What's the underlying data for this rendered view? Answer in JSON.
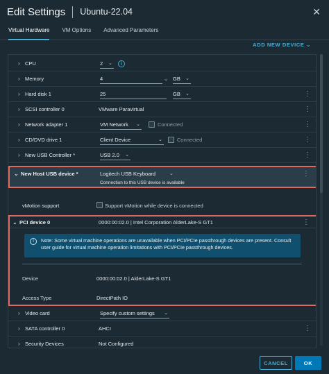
{
  "header": {
    "title": "Edit Settings",
    "vm_name": "Ubuntu-22.04",
    "close_icon": "close-icon"
  },
  "tabs": [
    {
      "label": "Virtual Hardware",
      "active": true
    },
    {
      "label": "VM Options",
      "active": false
    },
    {
      "label": "Advanced Parameters",
      "active": false
    }
  ],
  "toolbar": {
    "add_device_label": "ADD NEW DEVICE"
  },
  "colors": {
    "accent": "#49afd9",
    "highlight_border": "#e06a5f",
    "note_bg": "#10506e",
    "primary_button": "#0079b8"
  },
  "hardware": {
    "cpu": {
      "label": "CPU",
      "value": "2"
    },
    "memory": {
      "label": "Memory",
      "value": "4",
      "unit": "GB"
    },
    "hard_disk": {
      "label": "Hard disk 1",
      "value": "25",
      "unit": "GB"
    },
    "scsi": {
      "label": "SCSI controller 0",
      "value": "VMware Paravirtual"
    },
    "network": {
      "label": "Network adapter 1",
      "value": "VM Network",
      "connected_label": "Connected"
    },
    "cdrom": {
      "label": "CD/DVD drive 1",
      "value": "Client Device",
      "connected_label": "Connected"
    },
    "usb_controller": {
      "label": "New USB Controller *",
      "value": "USB 2.0"
    },
    "usb_device": {
      "label": "New Host USB device *",
      "value": "Logitech USB Keyboard",
      "status": "Connection to this USB device is available",
      "vmotion_label": "vMotion support",
      "vmotion_checkbox": "Support vMotion while device is connected"
    },
    "pci": {
      "label": "PCI device 0",
      "value": "0000:00:02.0 | Intel Corporation AlderLake-S GT1",
      "note": "Note: Some virtual machine operations are unavailable when PCI/PCIe passthrough devices are present. Consult user guide for virtual machine operation limitations with PCI/PCIe passthrough devices.",
      "device_label": "Device",
      "device_value": "0000:00:02.0 | AlderLake-S GT1",
      "access_label": "Access Type",
      "access_value": "DirectPath IO"
    },
    "video": {
      "label": "Video card",
      "value": "Specify custom settings"
    },
    "sata": {
      "label": "SATA controller 0",
      "value": "AHCI"
    },
    "security": {
      "label": "Security Devices",
      "value": "Not Configured"
    }
  },
  "footer": {
    "cancel_label": "CANCEL",
    "ok_label": "OK"
  }
}
